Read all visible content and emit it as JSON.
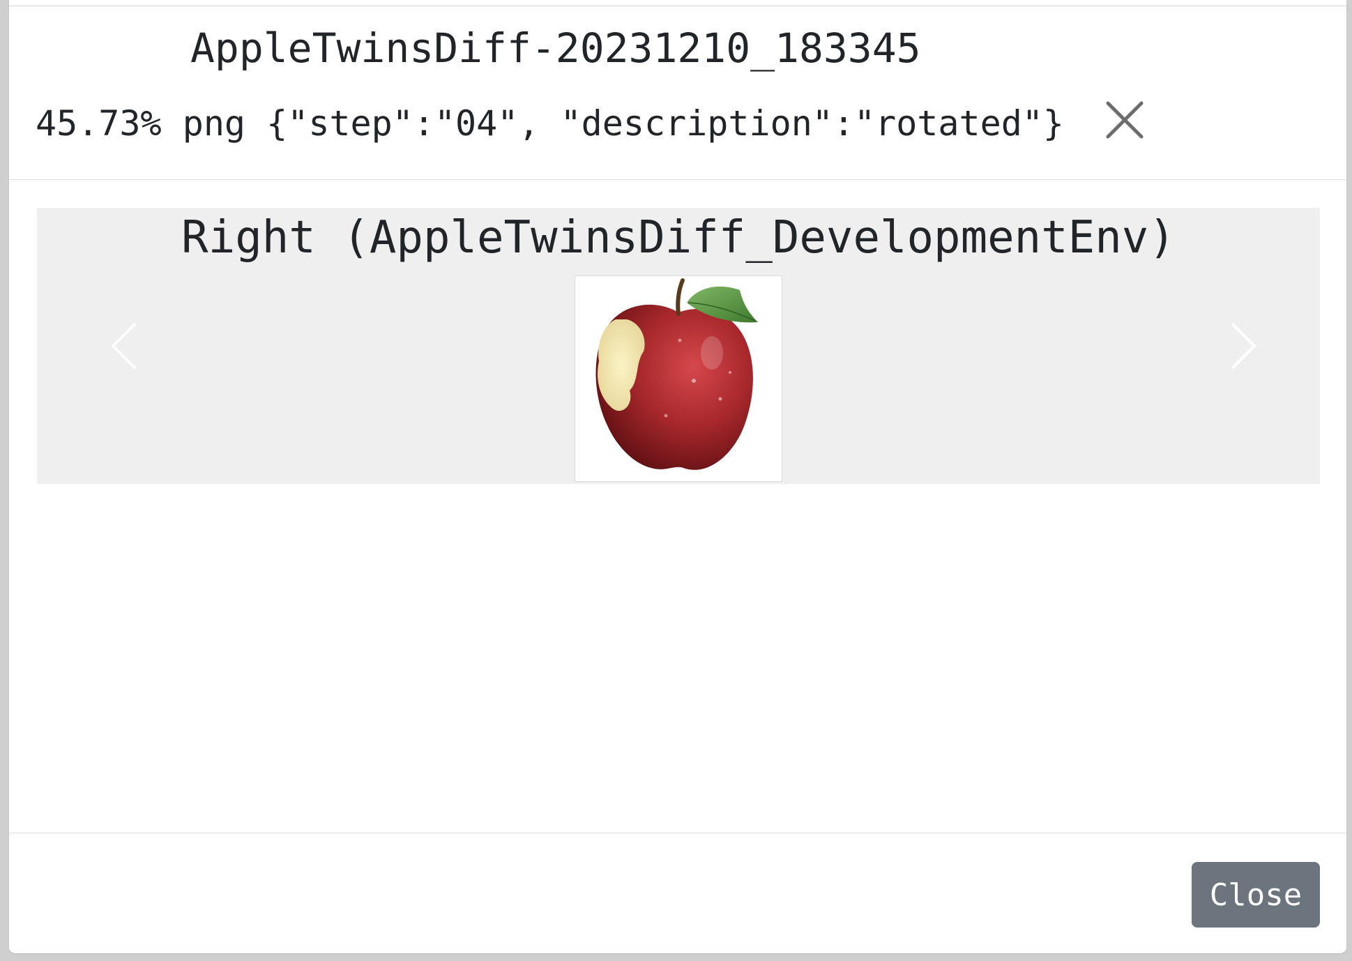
{
  "modal": {
    "title": "AppleTwinsDiff-20231210_183345",
    "meta": "45.73% png {\"step\":\"04\", \"description\":\"rotated\"}",
    "close_icon": "close-icon"
  },
  "carousel": {
    "caption": "Right (AppleTwinsDiff_DevelopmentEnv)",
    "image": "apple-image",
    "prev_icon": "chevron-left-icon",
    "next_icon": "chevron-right-icon"
  },
  "footer": {
    "close_label": "Close"
  },
  "colors": {
    "button_bg": "#6c757d",
    "carousel_bg": "#efefef"
  }
}
